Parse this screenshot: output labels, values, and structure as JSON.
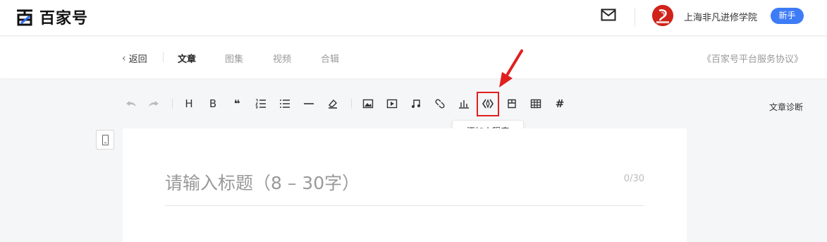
{
  "header": {
    "logo_text": "百家号",
    "username": "上海非凡进修学院",
    "badge": "新手"
  },
  "nav": {
    "back_label": "返回",
    "tabs": [
      {
        "label": "文章",
        "active": true
      },
      {
        "label": "图集",
        "active": false
      },
      {
        "label": "视频",
        "active": false
      },
      {
        "label": "合辑",
        "active": false
      }
    ],
    "agreement": "《百家号平台服务协议》"
  },
  "toolbar": {
    "heading": "H",
    "bold": "B",
    "quote": "❝",
    "hash": "#",
    "tooltip": "添加小程序",
    "diagnose": "文章诊断"
  },
  "editor": {
    "title_placeholder": "请输入标题（8 – 30字）",
    "counter": "0/30"
  },
  "colors": {
    "accent": "#3e7bf7",
    "highlight": "#e02020"
  }
}
